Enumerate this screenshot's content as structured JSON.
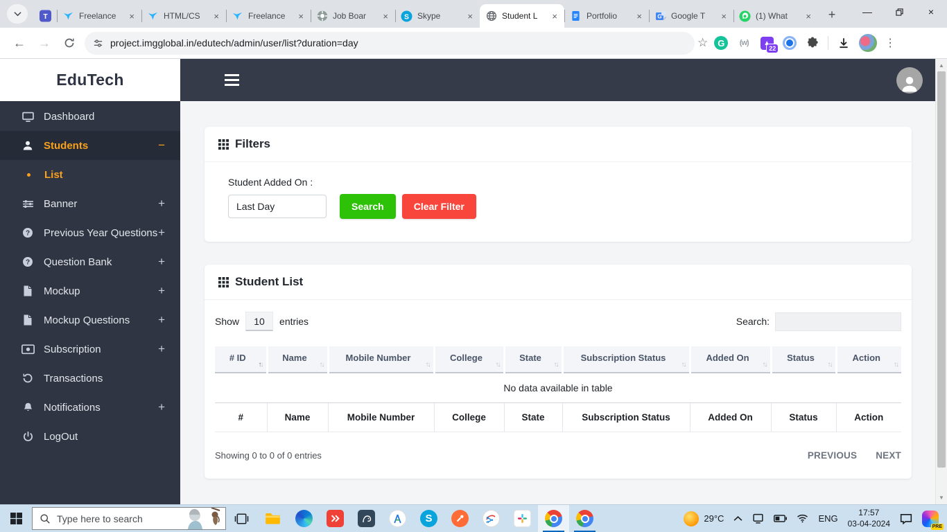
{
  "colors": {
    "accent-orange": "#f9a11c",
    "btn-green": "#2dc108",
    "btn-red": "#f9463c",
    "sidebar-bg": "#2f3542",
    "topbar-bg": "#353b48",
    "taskbar-bg": "#cde0f0",
    "run-blue": "#0067c0"
  },
  "browser": {
    "pinned_tab_icon": "teams",
    "tabs": [
      {
        "icon": "freelancer",
        "label": "Freelance"
      },
      {
        "icon": "freelancer",
        "label": "HTML/CS"
      },
      {
        "icon": "freelancer",
        "label": "Freelance"
      },
      {
        "icon": "chatgpt",
        "label": "Job Boar"
      },
      {
        "icon": "skype",
        "label": "Skype"
      },
      {
        "icon": "globe",
        "label": "Student L",
        "active": true
      },
      {
        "icon": "docs",
        "label": "Portfolio"
      },
      {
        "icon": "translate",
        "label": "Google T"
      },
      {
        "icon": "whatsapp",
        "label": "(1) What"
      }
    ],
    "url": "project.imgglobal.in/edutech/admin/user/list?duration=day",
    "extension_badge": "22",
    "grammarly_letter": "G",
    "w_ext_label": "(w)"
  },
  "sidebar": {
    "brand": "EduTech",
    "items": [
      {
        "label": "Dashboard",
        "icon": "monitor",
        "toggle": ""
      },
      {
        "label": "Students",
        "icon": "user",
        "toggle": "−",
        "active": true
      },
      {
        "label": "List",
        "sub": true
      },
      {
        "label": "Banner",
        "icon": "sliders",
        "toggle": "+"
      },
      {
        "label": "Previous Year Questions",
        "icon": "question",
        "toggle": "+"
      },
      {
        "label": "Question Bank",
        "icon": "question",
        "toggle": "+"
      },
      {
        "label": "Mockup",
        "icon": "file",
        "toggle": "+"
      },
      {
        "label": "Mockup Questions",
        "icon": "file",
        "toggle": "+"
      },
      {
        "label": "Subscription",
        "icon": "money",
        "toggle": "+"
      },
      {
        "label": "Transactions",
        "icon": "history",
        "toggle": ""
      },
      {
        "label": "Notifications",
        "icon": "bell",
        "toggle": "+"
      },
      {
        "label": "LogOut",
        "icon": "power",
        "toggle": ""
      }
    ]
  },
  "filters": {
    "title": "Filters",
    "field_label": "Student Added On :",
    "field_value": "Last Day",
    "search_label": "Search",
    "clear_label": "Clear Filter"
  },
  "student_list": {
    "title": "Student List",
    "show_label": "Show",
    "entries_value": "10",
    "entries_label": "entries",
    "search_label": "Search:",
    "columns": [
      "# ID",
      "Name",
      "Mobile Number",
      "College",
      "State",
      "Subscription Status",
      "Added On",
      "Status",
      "Action"
    ],
    "sorted_column": 0,
    "footer_columns": [
      "#",
      "Name",
      "Mobile Number",
      "College",
      "State",
      "Subscription Status",
      "Added On",
      "Status",
      "Action"
    ],
    "empty_text": "No data available in table",
    "summary": "Showing 0 to 0 of 0 entries",
    "prev_label": "PREVIOUS",
    "next_label": "NEXT"
  },
  "taskbar": {
    "search_placeholder": "Type here to search",
    "apps": [
      {
        "icon": "taskview",
        "name": "task-view-button"
      },
      {
        "icon": "explorer",
        "name": "file-explorer-button"
      },
      {
        "icon": "edge",
        "name": "edge-button"
      },
      {
        "icon": "anydesk",
        "name": "anydesk-button"
      },
      {
        "icon": "pgadmin",
        "name": "pgadmin-button"
      },
      {
        "icon": "designer",
        "name": "design-app-button"
      },
      {
        "icon": "skype-app",
        "name": "skype-button"
      },
      {
        "icon": "postman",
        "name": "postman-button"
      },
      {
        "icon": "snip",
        "name": "snipping-tool-button"
      },
      {
        "icon": "slack",
        "name": "slack-button"
      },
      {
        "icon": "chrome",
        "name": "chrome-button",
        "running": true,
        "active": true
      },
      {
        "icon": "chrome",
        "name": "chrome-button-2",
        "running": true
      }
    ],
    "temperature": "29°C",
    "language": "ENG",
    "time": "17:57",
    "date": "03-04-2024",
    "copilot_badge": "PRE"
  }
}
